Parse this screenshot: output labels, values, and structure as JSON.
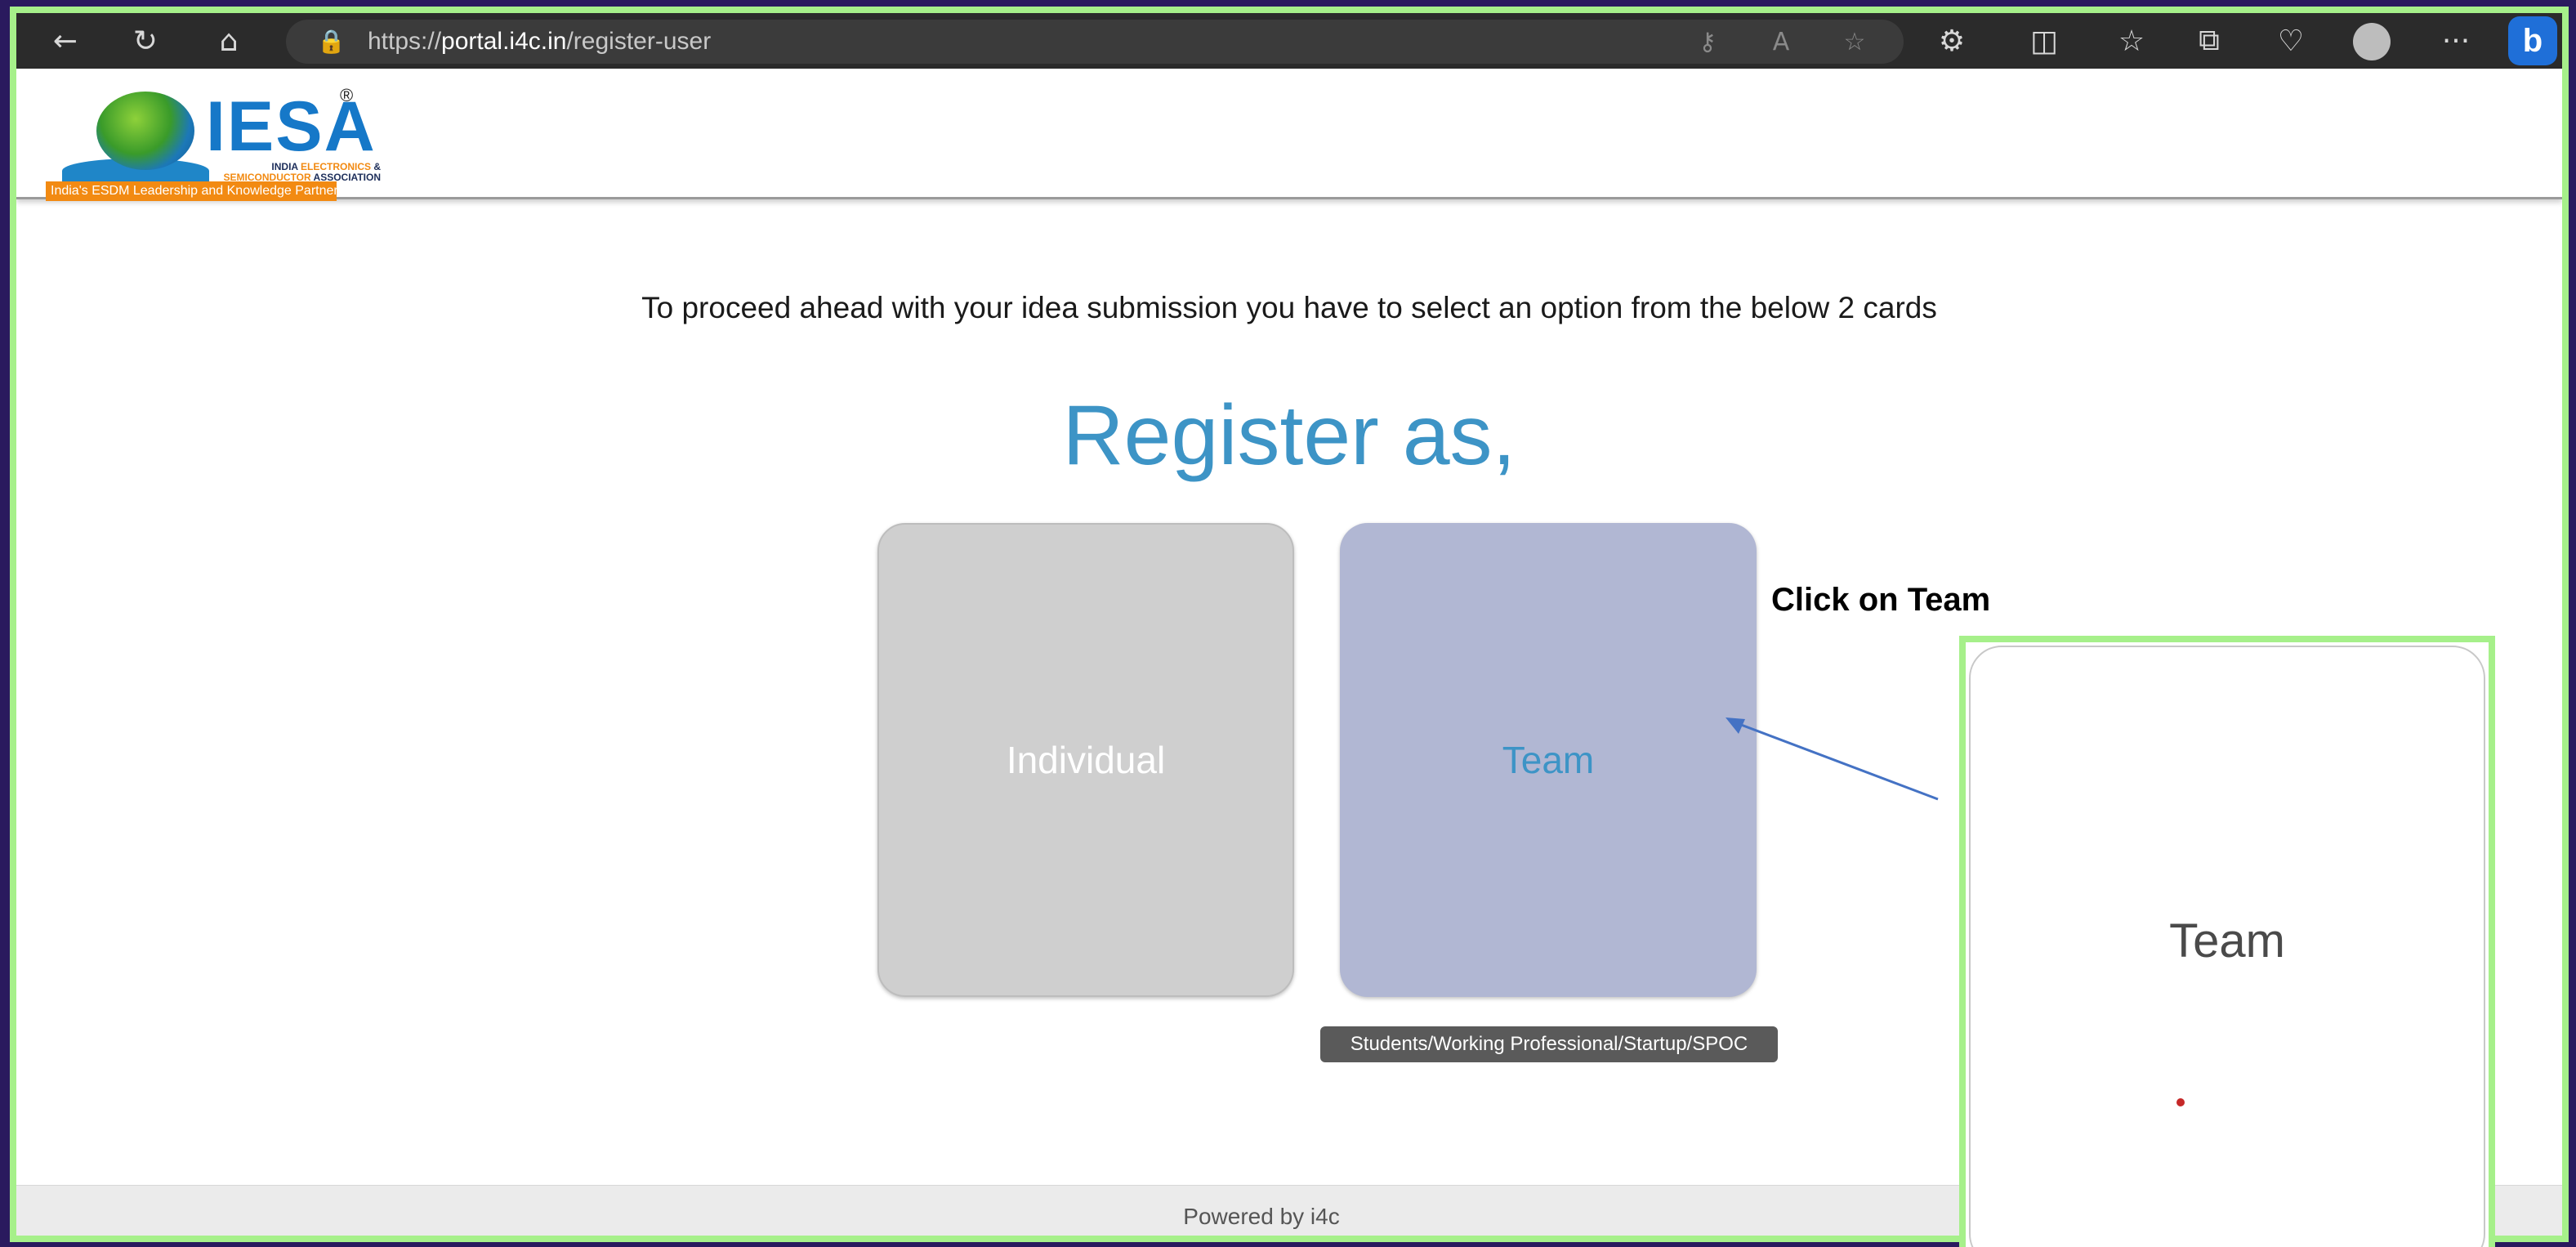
{
  "browser": {
    "url_prefix": "https://",
    "url_host": "portal.i4c.in",
    "url_path": "/register-user",
    "icons": [
      "back-icon",
      "refresh-icon",
      "home-icon",
      "lock-icon",
      "key-icon",
      "read-aloud-icon",
      "favorite-icon",
      "extensions-icon",
      "split-screen-icon",
      "favorites-list-icon",
      "collections-icon",
      "health-icon",
      "profile-icon",
      "more-icon",
      "bing-icon"
    ],
    "more_label": "···",
    "bing_label": "b"
  },
  "header": {
    "logo_text_main": "IESA",
    "logo_reg": "®",
    "logo_line1_a": "INDIA ",
    "logo_line1_b": "ELECTRONICS",
    "logo_line1_c": " &",
    "logo_line2_a": "SEMICONDUCTOR",
    "logo_line2_b": " ASSOCIATION",
    "logo_tagline": "India's ESDM Leadership and Knowledge Partner"
  },
  "main": {
    "instruction": "To proceed ahead with your idea submission you have to select an option from the below 2 cards",
    "title": "Register as,",
    "cards": [
      {
        "label": "Individual"
      },
      {
        "label": "Team"
      }
    ],
    "tooltip": "Students/Working Professional/Startup/SPOC"
  },
  "footer": {
    "text": "Powered by i4c"
  },
  "annotation": {
    "instruction": "Click on Team",
    "zoom_label": "Team",
    "arrow_color": "#4472c4",
    "highlight_color": "#a6f08a"
  }
}
